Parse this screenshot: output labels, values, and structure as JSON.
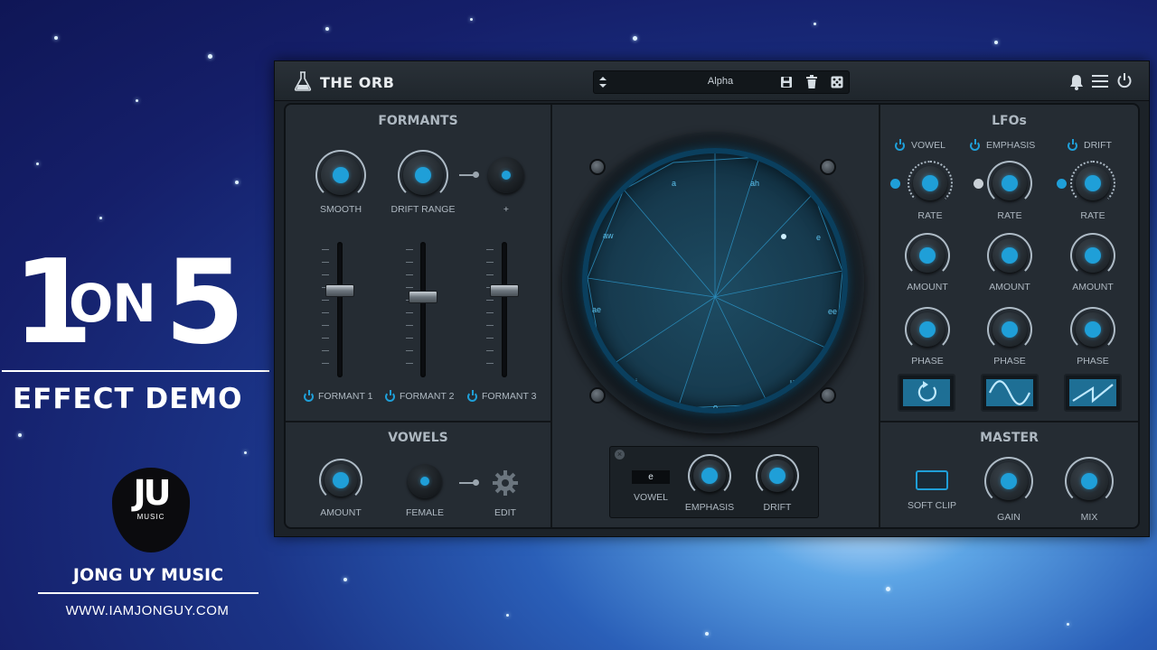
{
  "branding": {
    "big_one": "1",
    "on": "ON",
    "big_five": "5",
    "subtitle": "EFFECT DEMO",
    "logo_letters": "JU",
    "logo_small": "MUSIC",
    "channel_name": "JONG UY MUSIC",
    "website": "WWW.IAMJONGUY.COM"
  },
  "plugin": {
    "title": "THE ORB",
    "preset": {
      "name": "Alpha",
      "icons": [
        "up-down-arrows-icon",
        "save-icon",
        "trash-icon",
        "dice-icon"
      ]
    },
    "header_icons": [
      "bell-icon",
      "menu-icon",
      "power-icon"
    ],
    "accent_color": "#1f9fd8"
  },
  "formants": {
    "title": "FORMANTS",
    "smooth_label": "SMOOTH",
    "drift_range_label": "DRIFT RANGE",
    "plus_label": "+",
    "faders": [
      {
        "label": "FORMANT 1",
        "level": 0.62
      },
      {
        "label": "FORMANT 2",
        "level": 0.57
      },
      {
        "label": "FORMANT 3",
        "level": 0.62
      }
    ]
  },
  "vowels": {
    "title": "VOWELS",
    "amount_label": "AMOUNT",
    "female_label": "FEMALE",
    "edit_label": "EDIT"
  },
  "orb": {
    "labels": [
      "a",
      "ah",
      "e",
      "ee",
      "u",
      "o",
      "i",
      "ae",
      "aw"
    ],
    "selected_vowel": "e",
    "vowel_label": "VOWEL",
    "emphasis_label": "EMPHASIS",
    "drift_label": "DRIFT"
  },
  "lfos": {
    "title": "LFOs",
    "columns": [
      {
        "name": "VOWEL",
        "rate_label": "RATE",
        "amount_label": "AMOUNT",
        "phase_label": "PHASE",
        "shape": "loop"
      },
      {
        "name": "EMPHASIS",
        "rate_label": "RATE",
        "amount_label": "AMOUNT",
        "phase_label": "PHASE",
        "shape": "sine"
      },
      {
        "name": "DRIFT",
        "rate_label": "RATE",
        "amount_label": "AMOUNT",
        "phase_label": "PHASE",
        "shape": "saw"
      }
    ]
  },
  "master": {
    "title": "MASTER",
    "soft_clip_label": "SOFT CLIP",
    "gain_label": "GAIN",
    "mix_label": "MIX"
  }
}
